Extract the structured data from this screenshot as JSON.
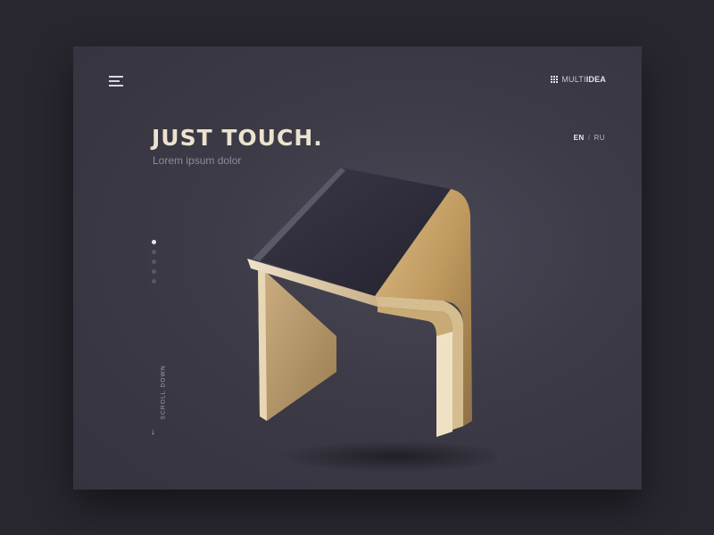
{
  "header": {
    "menu_icon": "hamburger-menu-icon",
    "logo_icon": "grid-dots-icon",
    "logo_light": "MULTI",
    "logo_bold": "IDEA"
  },
  "hero": {
    "title": "JUST TOUCH.",
    "subtitle": "Lorem ipsum dolor"
  },
  "language": {
    "active": "EN",
    "separator": "/",
    "other": "RU"
  },
  "pagination": {
    "count": 5,
    "active_index": 0
  },
  "scroll": {
    "label": "SCROLL DOWN",
    "arrow": "↓"
  },
  "colors": {
    "page_bg": "#28262f",
    "panel_bg": "#3c3a46",
    "title": "#ece3cf",
    "wood": "#c7a46d",
    "screen": "#2f2d3d"
  }
}
